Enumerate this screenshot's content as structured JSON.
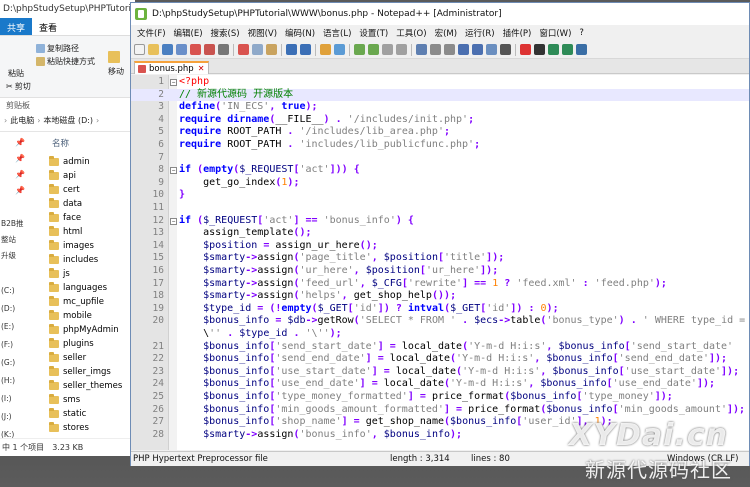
{
  "explorer": {
    "title": "D:\\phpStudySetup\\PHPTutorial\\",
    "tabs": [
      "共享",
      "查看"
    ],
    "ribbon": {
      "copy_path": "复制路径",
      "paste_shortcut": "粘贴快捷方式",
      "paste": "粘贴",
      "cut": "剪切",
      "move_to": "移动",
      "clipboard_group": "剪贴板"
    },
    "address": [
      "此电脑",
      "本地磁盘 (D:)"
    ],
    "column_header": "名称",
    "nav_items": [
      "B2B推",
      "整站",
      "升级",
      "(C:)",
      "(D:)",
      "(E:)",
      "(F:)",
      "(G:)",
      "(H:)",
      "(I:)",
      "(J:)",
      "(K:)"
    ],
    "folders": [
      "admin",
      "api",
      "cert",
      "data",
      "face",
      "html",
      "images",
      "includes",
      "js",
      "languages",
      "mc_upfile",
      "mobile",
      "phpMyAdmin",
      "plugins",
      "seller",
      "seller_imgs",
      "seller_themes",
      "sms",
      "static",
      "stores"
    ],
    "status": {
      "selected": "中 1 个项目",
      "size": "3.23 KB"
    }
  },
  "npp": {
    "title": "D:\\phpStudySetup\\PHPTutorial\\WWW\\bonus.php - Notepad++ [Administrator]",
    "menu": [
      "文件(F)",
      "编辑(E)",
      "搜索(S)",
      "视图(V)",
      "编码(N)",
      "语言(L)",
      "设置(T)",
      "工具(O)",
      "宏(M)",
      "运行(R)",
      "插件(P)",
      "窗口(W)",
      "?"
    ],
    "tab_label": "bonus.php",
    "status": {
      "lang": "PHP Hypertext Preprocessor file",
      "length": "length : 3,314",
      "lines": "lines : 80",
      "eol": "Windows (CR LF)"
    }
  },
  "code": [
    {
      "n": "1",
      "t": "<?php"
    },
    {
      "n": "2",
      "t": "// 新源代源码 开源版本"
    },
    {
      "n": "3",
      "t": "define('IN_ECS', true);"
    },
    {
      "n": "4",
      "t": "require dirname(__FILE__) . '/includes/init.php';"
    },
    {
      "n": "5",
      "t": "require ROOT_PATH . '/includes/lib_area.php';"
    },
    {
      "n": "6",
      "t": "require ROOT_PATH . 'includes/lib_publicfunc.php';"
    },
    {
      "n": "7",
      "t": ""
    },
    {
      "n": "8",
      "t": "if (empty($_REQUEST['act'])) {"
    },
    {
      "n": "9",
      "t": "    get_go_index(1);"
    },
    {
      "n": "10",
      "t": "}"
    },
    {
      "n": "11",
      "t": ""
    },
    {
      "n": "12",
      "t": "if ($_REQUEST['act'] == 'bonus_info') {"
    },
    {
      "n": "13",
      "t": "    assign_template();"
    },
    {
      "n": "14",
      "t": "    $position = assign_ur_here();"
    },
    {
      "n": "15",
      "t": "    $smarty->assign('page_title', $position['title']);"
    },
    {
      "n": "16",
      "t": "    $smarty->assign('ur_here', $position['ur_here']);"
    },
    {
      "n": "17",
      "t": "    $smarty->assign('feed_url', $_CFG['rewrite'] == 1 ? 'feed.xml' : 'feed.php');"
    },
    {
      "n": "18",
      "t": "    $smarty->assign('helps', get_shop_help());"
    },
    {
      "n": "19",
      "t": "    $type_id = (!empty($_GET['id']) ? intval($_GET['id']) : 0);"
    },
    {
      "n": "20",
      "t": "    $bonus_info = $db->getRow('SELECT * FROM ' . $ecs->table('bonus_type') . ' WHERE type_id = "
    },
    {
      "n": "",
      "t": "    \\'' . $type_id . '\\'');"
    },
    {
      "n": "21",
      "t": "    $bonus_info['send_start_date'] = local_date('Y-m-d H:i:s', $bonus_info['send_start_date'"
    },
    {
      "n": "22",
      "t": "    $bonus_info['send_end_date'] = local_date('Y-m-d H:i:s', $bonus_info['send_end_date']);"
    },
    {
      "n": "23",
      "t": "    $bonus_info['use_start_date'] = local_date('Y-m-d H:i:s', $bonus_info['use_start_date']);"
    },
    {
      "n": "24",
      "t": "    $bonus_info['use_end_date'] = local_date('Y-m-d H:i:s', $bonus_info['use_end_date']);"
    },
    {
      "n": "25",
      "t": "    $bonus_info['type_money_formatted'] = price_format($bonus_info['type_money']);"
    },
    {
      "n": "26",
      "t": "    $bonus_info['min_goods_amount_formatted'] = price_format($bonus_info['min_goods_amount']);"
    },
    {
      "n": "27",
      "t": "    $bonus_info['shop_name'] = get_shop_name($bonus_info['user_id'], 1);"
    },
    {
      "n": "28",
      "t": "    $smarty->assign('bonus_info', $bonus_info);"
    }
  ],
  "watermark": {
    "logo": "XYDai.cn",
    "sub": "新源代源码社区"
  },
  "colors": {
    "accent": "#1979ca",
    "tab_marker": "#f6a23b",
    "current_line": "#e8e8ff"
  }
}
